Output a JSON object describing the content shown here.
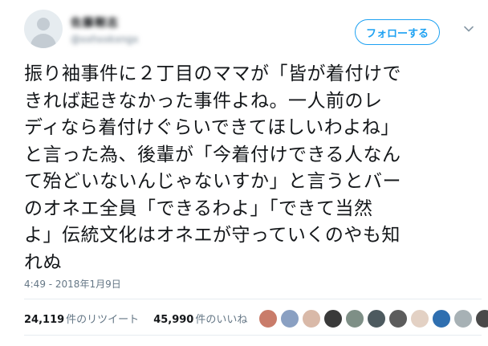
{
  "tweet": {
    "author": {
      "display_name": "佐藤剛志",
      "handle": "@xxhxxkxngx"
    },
    "follow_label": "フォローする",
    "text_lines": [
      "振り袖事件に２丁目のママが「皆が着付けで",
      "きれば起きなかった事件よね。一人前のレ",
      "ディなら着付けぐらいできてほしいわよね」",
      "と言った為、後輩が「今着付けできる人なん",
      "て殆どいないんじゃないすか」と言うとバー",
      "のオネエ全員「できるわよ」「できて当然",
      "よ」伝統文化はオネエが守っていくのやも知",
      "れぬ"
    ],
    "timestamp": "4:49 - 2018年1月9日"
  },
  "stats": {
    "retweets_count": "24,119",
    "retweets_label": "件のリツイート",
    "likes_count": "45,990",
    "likes_label": "件のいいね"
  },
  "likers": {
    "avatar_colors": [
      "#c97c6a",
      "#8aa0c2",
      "#d9b9a8",
      "#3a3a3a",
      "#7e8f86",
      "#4d5a5f",
      "#5c5c5c",
      "#e3d1c4",
      "#2f6fb0",
      "#a7b1b5",
      "#494949"
    ]
  }
}
